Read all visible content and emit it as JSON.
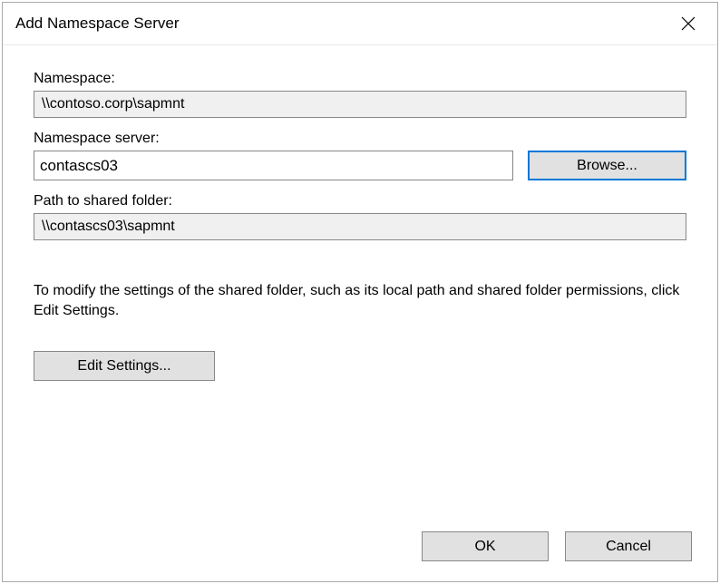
{
  "title": "Add Namespace Server",
  "labels": {
    "namespace": "Namespace:",
    "namespace_server": "Namespace server:",
    "path_to_shared_folder": "Path to shared folder:"
  },
  "values": {
    "namespace": "\\\\contoso.corp\\sapmnt",
    "namespace_server": "contascs03",
    "path_to_shared_folder": "\\\\contascs03\\sapmnt"
  },
  "buttons": {
    "browse": "Browse...",
    "edit_settings": "Edit Settings...",
    "ok": "OK",
    "cancel": "Cancel"
  },
  "help_text": "To modify the settings of the shared folder, such as its local path and shared folder permissions, click Edit Settings."
}
